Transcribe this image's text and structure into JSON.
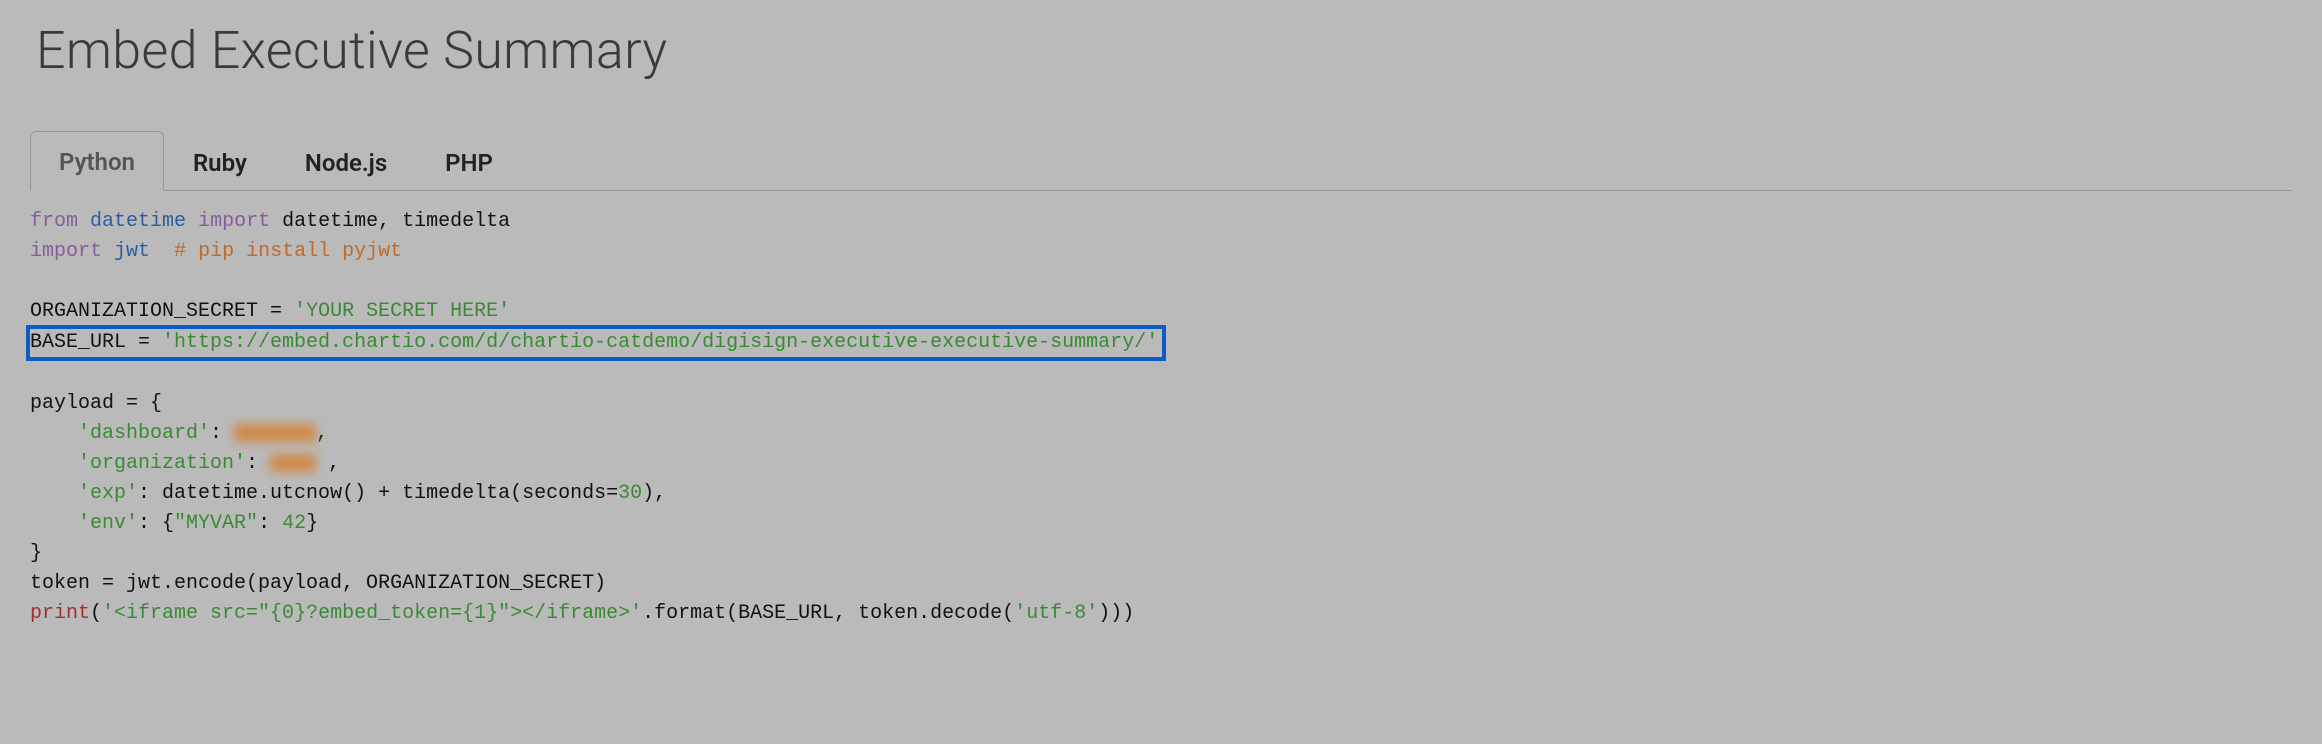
{
  "title": "Embed Executive Summary",
  "tabs": [
    {
      "label": "Python",
      "active": true
    },
    {
      "label": "Ruby",
      "active": false
    },
    {
      "label": "Node.js",
      "active": false
    },
    {
      "label": "PHP",
      "active": false
    }
  ],
  "code": {
    "l1_from": "from",
    "l1_mod1": "datetime",
    "l1_import": "import",
    "l1_names": "datetime, timedelta",
    "l2_import": "import",
    "l2_mod": "jwt",
    "l2_cmt": "# pip install pyjwt",
    "l4_var": "ORGANIZATION_SECRET",
    "l4_eq": " = ",
    "l4_str": "'YOUR SECRET HERE'",
    "l5_var": "BASE_URL",
    "l5_eq": " = ",
    "l5_str": "'https://embed.chartio.com/d/chartio-catdemo/digisign-executive-executive-summary/'",
    "l7_var": "payload",
    "l7_eq": " = {",
    "l8_indent": "    ",
    "l8_key": "'dashboard'",
    "l8_colon": ": ",
    "l8_comma": ",",
    "l9_key": "'organization'",
    "l9_colon": ": ",
    "l9_comma": ",",
    "l10_key": "'exp'",
    "l10_rest": ": datetime.utcnow() + timedelta(seconds=",
    "l10_num": "30",
    "l10_close": "),",
    "l11_key": "'env'",
    "l11_colon": ": {",
    "l11_inner_key": "\"MYVAR\"",
    "l11_colon2": ": ",
    "l11_num": "42",
    "l11_close": "}",
    "l12_close": "}",
    "l13_var": "token",
    "l13_rest": " = jwt.encode(payload, ORGANIZATION_SECRET)",
    "l14_print": "print",
    "l14_open": "(",
    "l14_str": "'<iframe src=\"{0}?embed_token={1}\"></iframe>'",
    "l14_rest": ".format(BASE_URL, token.decode(",
    "l14_utf": "'utf-8'",
    "l14_close": ")))"
  }
}
